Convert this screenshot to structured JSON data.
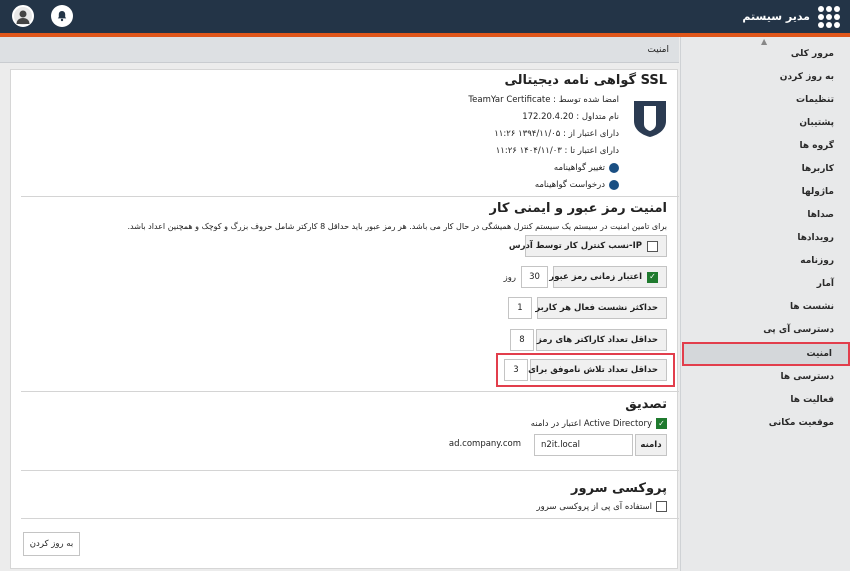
{
  "header": {
    "app_title": "مدیر سیستم"
  },
  "breadcrumb": "امنیت",
  "sidebar": {
    "items": [
      {
        "label": "مرور کلی"
      },
      {
        "label": "به روز کردن"
      },
      {
        "label": "تنظیمات"
      },
      {
        "label": "پشتیبان"
      },
      {
        "label": "گروه ها"
      },
      {
        "label": "کاربرها"
      },
      {
        "label": "ماژولها"
      },
      {
        "label": "صداها"
      },
      {
        "label": "رویدادها"
      },
      {
        "label": "روزنامه"
      },
      {
        "label": "آمار"
      },
      {
        "label": "نشست ها"
      },
      {
        "label": "دسترسی آی پی"
      },
      {
        "label": "امنیت",
        "active": true
      },
      {
        "label": "دسترسی ها"
      },
      {
        "label": "فعالیت ها"
      },
      {
        "label": "موقعیت مکانی"
      }
    ]
  },
  "ssl": {
    "title": "SSL گواهی نامه دیجیتالی",
    "signed_by": "امضا شده توسط : TeamYar Certificate",
    "common_name": "نام متداول : 172.20.4.20",
    "valid_from": "دارای اعتبار از : ۱۳۹۴/۱۱/۰۵ ۱۱:۲۶",
    "valid_to": "دارای اعتبار تا : ۱۴۰۴/۱۱/۰۳ ۱۱:۲۶",
    "change_cert": "تغییر گواهینامه",
    "request_cert": "درخواست گواهینامه"
  },
  "password": {
    "title": "امنیت رمز عبور و ایمنی کار",
    "description": "برای تامین امنیت در سیستم یک سیستم کنترل همیشگی در حال کار می باشد. هر رمز عبور باید حداقل 8 کارکتر شامل حروف بزرگ و کوچک و همچنین اعداد باشد.",
    "ip_control_label": "IP-نسب کنترل کار توسط آدرس",
    "ip_control_checked": false,
    "expiry_label": "اعتبار زمانی رمز عبور",
    "expiry_checked": true,
    "expiry_value": "30",
    "expiry_unit": "روز",
    "max_sessions_label": "حداکثر نشست فعال هر کاربر",
    "max_sessions_value": "1",
    "min_chars_label": "حداقل تعداد کاراکتر های رمز عبور",
    "min_chars_value": "8",
    "failed_login_label": "حداقل تعداد تلاش ناموفق برای ورود",
    "failed_login_value": "3"
  },
  "auth": {
    "title": "تصدیق",
    "ad_label": "Active Directory اعتبار در دامنه",
    "ad_checked": true,
    "domain_label": "دامنه",
    "domain_value": "n2it.local",
    "domain_hint": "ad.company.com"
  },
  "proxy": {
    "title": "پروکسی سرور",
    "use_proxy_label": "استفاده آی پی از پروکسی سرور",
    "use_proxy_checked": false
  },
  "footer": {
    "refresh_label": "به روز کردن"
  },
  "colors": {
    "topbar": "#233447",
    "accent": "#e0561a",
    "highlight": "#e23e4c",
    "check_green": "#1f7a2e",
    "link_dot": "#1a4f83"
  }
}
